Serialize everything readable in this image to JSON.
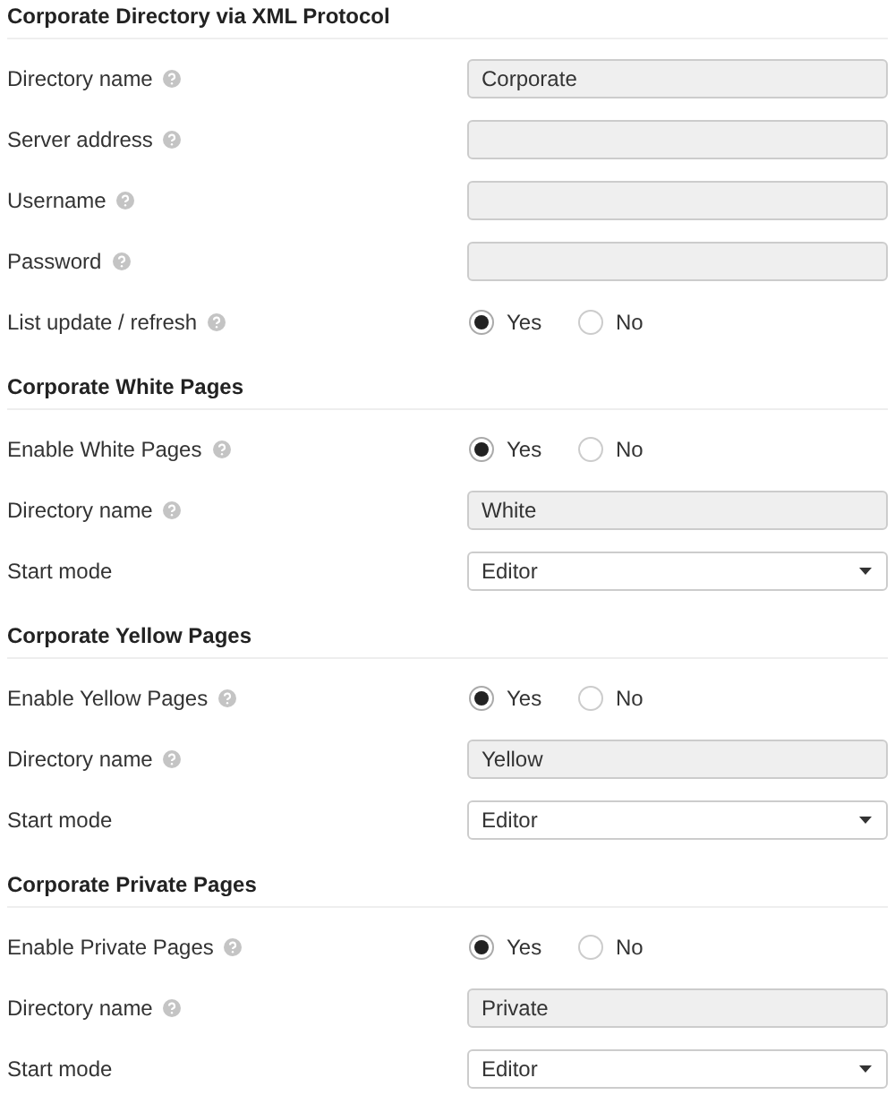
{
  "sections": [
    {
      "title": "Corporate Directory via XML Protocol",
      "rows": [
        {
          "kind": "text",
          "label": "Directory name",
          "help": true,
          "value": "Corporate"
        },
        {
          "kind": "text",
          "label": "Server address",
          "help": true
        },
        {
          "kind": "text",
          "label": "Username",
          "help": true
        },
        {
          "kind": "text",
          "label": "Password",
          "help": true
        },
        {
          "kind": "radio",
          "label": "List update / refresh",
          "help": true,
          "options": [
            {
              "label": "Yes",
              "selected": true
            },
            {
              "label": "No",
              "selected": false
            }
          ]
        }
      ]
    },
    {
      "title": "Corporate White Pages",
      "rows": [
        {
          "kind": "radio",
          "label": "Enable White Pages",
          "help": true,
          "options": [
            {
              "label": "Yes",
              "selected": true
            },
            {
              "label": "No",
              "selected": false
            }
          ]
        },
        {
          "kind": "text",
          "label": "Directory name",
          "help": true,
          "value": "White"
        },
        {
          "kind": "select",
          "label": "Start mode",
          "help": false,
          "value": "Editor"
        }
      ]
    },
    {
      "title": "Corporate Yellow Pages",
      "rows": [
        {
          "kind": "radio",
          "label": "Enable Yellow Pages",
          "help": true,
          "options": [
            {
              "label": "Yes",
              "selected": true
            },
            {
              "label": "No",
              "selected": false
            }
          ]
        },
        {
          "kind": "text",
          "label": "Directory name",
          "help": true,
          "value": "Yellow"
        },
        {
          "kind": "select",
          "label": "Start mode",
          "help": false,
          "value": "Editor"
        }
      ]
    },
    {
      "title": "Corporate Private Pages",
      "rows": [
        {
          "kind": "radio",
          "label": "Enable Private Pages",
          "help": true,
          "options": [
            {
              "label": "Yes",
              "selected": true
            },
            {
              "label": "No",
              "selected": false
            }
          ]
        },
        {
          "kind": "text",
          "label": "Directory name",
          "help": true,
          "value": "Private"
        },
        {
          "kind": "select",
          "label": "Start mode",
          "help": false,
          "value": "Editor"
        }
      ]
    }
  ]
}
